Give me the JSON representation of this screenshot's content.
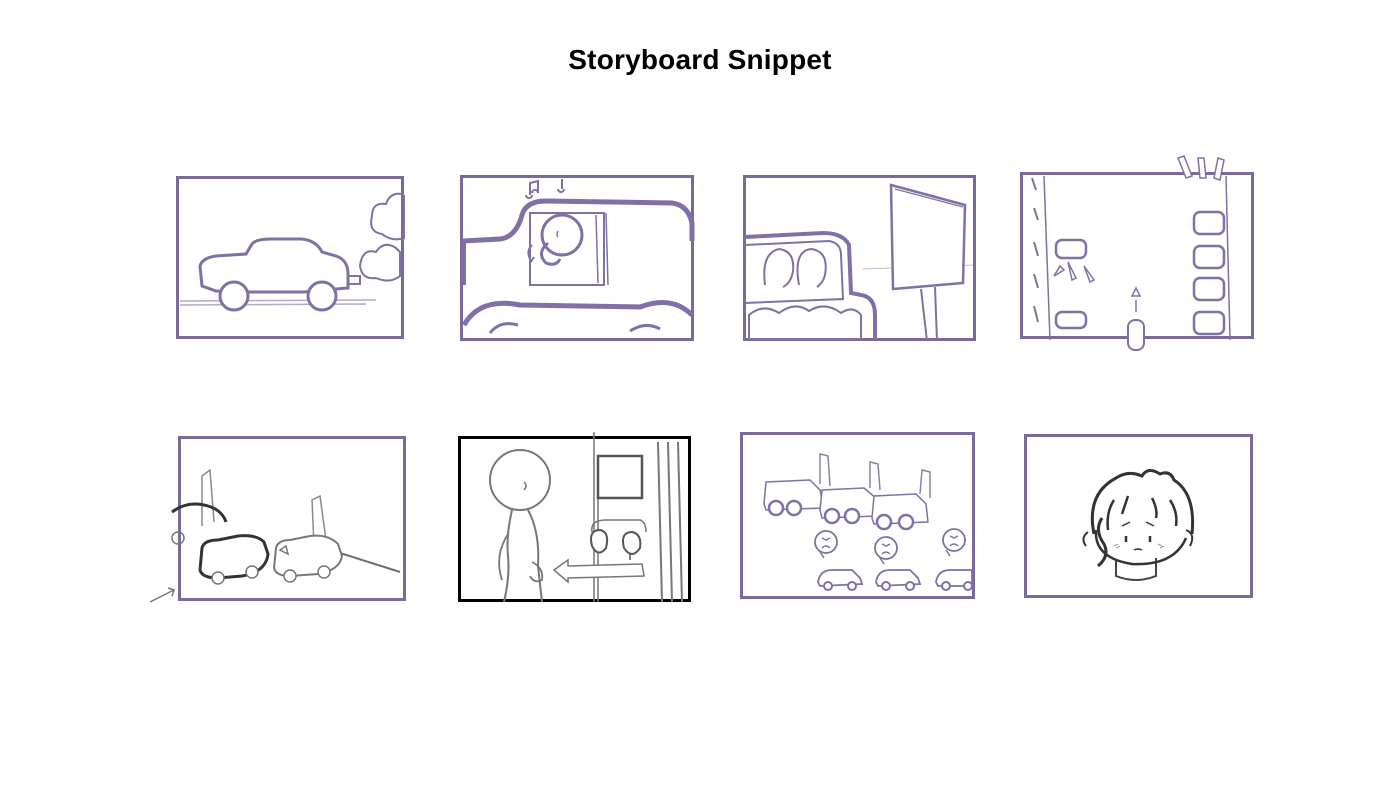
{
  "page": {
    "title": "Storyboard Snippet"
  },
  "colors": {
    "frame": "#7a6a99",
    "sketch": "#8070a5",
    "pencil": "#6e6e6e",
    "ink": "#000000",
    "background": "#ffffff"
  },
  "panels": [
    {
      "id": 1,
      "subject": "car-exhaust"
    },
    {
      "id": 2,
      "subject": "driver-singing"
    },
    {
      "id": 3,
      "subject": "billboard-passengers"
    },
    {
      "id": 4,
      "subject": "parking-lot-overhead"
    },
    {
      "id": 5,
      "subject": "cars-parking"
    },
    {
      "id": 6,
      "subject": "person-walking-door"
    },
    {
      "id": 7,
      "subject": "traffic-jam-angry"
    },
    {
      "id": 8,
      "subject": "worried-character"
    }
  ]
}
